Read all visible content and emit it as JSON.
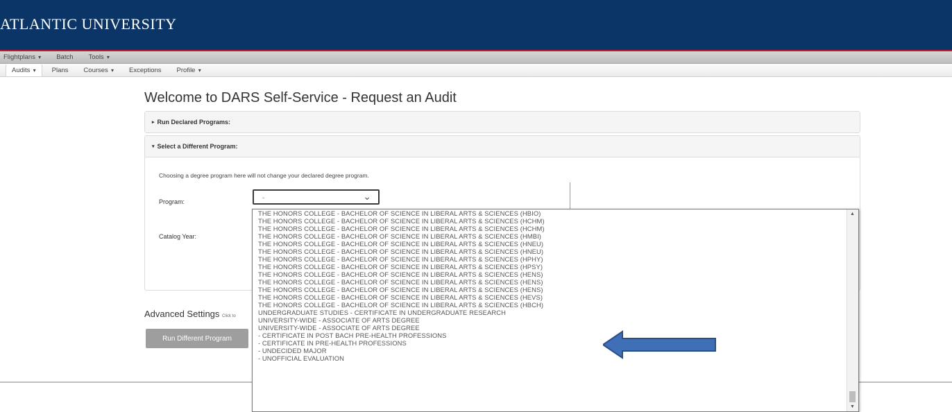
{
  "header": {
    "title": "ATLANTIC UNIVERSITY"
  },
  "nav_primary": [
    "Flightplans",
    "Batch",
    "Tools"
  ],
  "nav_secondary": [
    "Audits",
    "Plans",
    "Courses",
    "Exceptions",
    "Profile"
  ],
  "page_title": "Welcome to DARS Self-Service - Request an Audit",
  "panel_declared": {
    "label": "Run Declared Programs:"
  },
  "panel_different": {
    "label": "Select a Different Program:",
    "note": "Choosing a degree program here will not change your declared degree program.",
    "program_label": "Program:",
    "program_value": "-",
    "catalog_label": "Catalog Year:"
  },
  "advanced": {
    "label": "Advanced Settings",
    "hint": "Click to"
  },
  "run_button": "Run Different Program",
  "dropdown_options": [
    "THE HONORS COLLEGE - BACHELOR OF SCIENCE IN LIBERAL ARTS & SCIENCES (HBIO)",
    "THE HONORS COLLEGE - BACHELOR OF SCIENCE IN LIBERAL ARTS & SCIENCES (HCHM)",
    "THE HONORS COLLEGE - BACHELOR OF SCIENCE IN LIBERAL ARTS & SCIENCES (HCHM)",
    "THE HONORS COLLEGE - BACHELOR OF SCIENCE IN LIBERAL ARTS & SCIENCES (HMBI)",
    "THE HONORS COLLEGE - BACHELOR OF SCIENCE IN LIBERAL ARTS & SCIENCES (HNEU)",
    "THE HONORS COLLEGE - BACHELOR OF SCIENCE IN LIBERAL ARTS & SCIENCES (HNEU)",
    "THE HONORS COLLEGE - BACHELOR OF SCIENCE IN LIBERAL ARTS & SCIENCES (HPHY)",
    "THE HONORS COLLEGE - BACHELOR OF SCIENCE IN LIBERAL ARTS & SCIENCES (HPSY)",
    "THE HONORS COLLEGE - BACHELOR OF SCIENCE IN LIBERAL ARTS & SCIENCES (HENS)",
    "THE HONORS COLLEGE - BACHELOR OF SCIENCE IN LIBERAL ARTS & SCIENCES (HENS)",
    "THE HONORS COLLEGE - BACHELOR OF SCIENCE IN LIBERAL ARTS & SCIENCES (HENS)",
    "THE HONORS COLLEGE - BACHELOR OF SCIENCE IN LIBERAL ARTS & SCIENCES (HEVS)",
    "THE HONORS COLLEGE - BACHELOR OF SCIENCE IN LIBERAL ARTS & SCIENCES (HBCH)",
    "UNDERGRADUATE STUDIES - CERTIFICATE IN UNDERGRADUATE RESEARCH",
    "UNIVERSITY-WIDE - ASSOCIATE OF ARTS DEGREE",
    "UNIVERSITY-WIDE - ASSOCIATE OF ARTS DEGREE",
    "- CERTIFICATE IN POST BACH PRE-HEALTH PROFESSIONS",
    "- CERTIFICATE IN PRE-HEALTH PROFESSIONS",
    "- UNDECIDED MAJOR",
    "- UNOFFICIAL EVALUATION"
  ],
  "colors": {
    "header_bg": "#0b3566",
    "header_rule": "#c4192b",
    "annotation_arrow": "#3f6fb6"
  },
  "icons": {
    "dropdown": "chevron-down-icon",
    "menu": "caret-down-icon",
    "annotation": "arrow-left-icon"
  }
}
